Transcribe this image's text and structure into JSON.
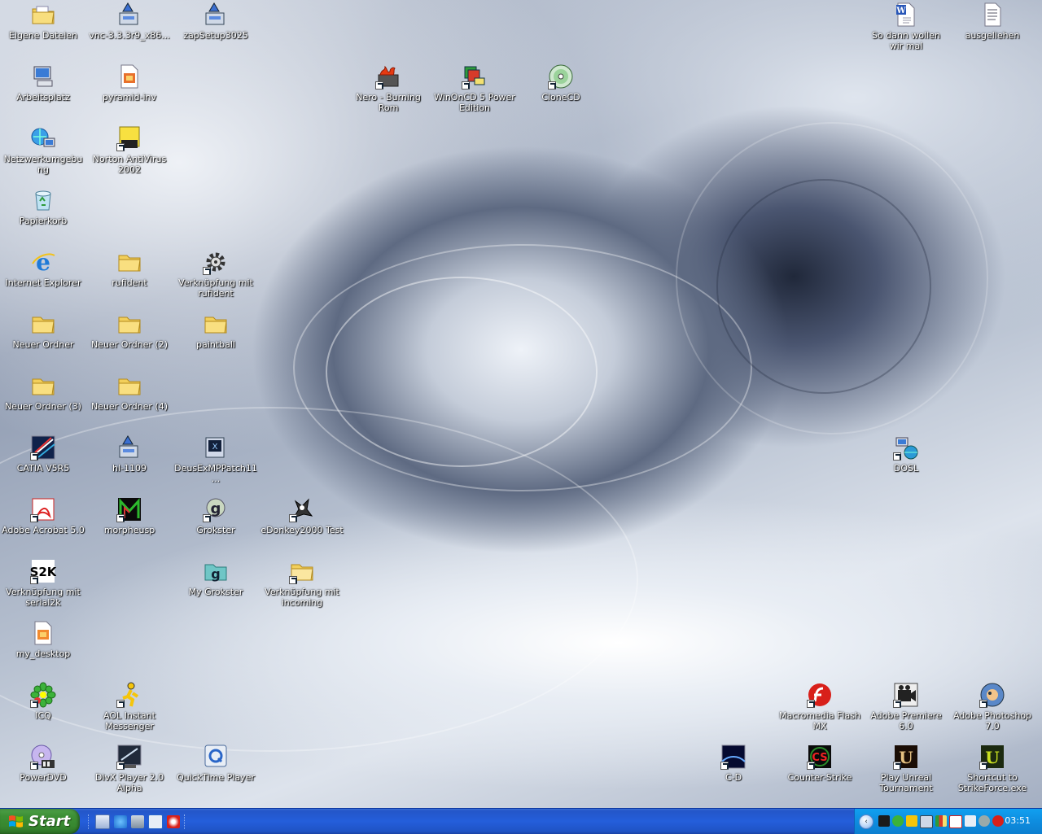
{
  "desktop": {
    "icons": [
      {
        "label": "Eigene Dateien",
        "icon": "folder-documents-icon"
      },
      {
        "label": "vnc-3.3.3r9_x86...",
        "icon": "installer-icon"
      },
      {
        "label": "zapSetup3025",
        "icon": "installer-icon"
      },
      {
        "label": "So dann wollen wir mal",
        "icon": "word-document-icon"
      },
      {
        "label": "ausgeliehen",
        "icon": "text-document-icon"
      },
      {
        "label": "Arbeitsplatz",
        "icon": "my-computer-icon"
      },
      {
        "label": "pyramid-inv",
        "icon": "image-file-icon"
      },
      {
        "label": "Nero - Burning Rom",
        "icon": "nero-icon"
      },
      {
        "label": "WinOnCD 5 Power Edition",
        "icon": "winoncd-icon"
      },
      {
        "label": "CloneCD",
        "icon": "cd-icon"
      },
      {
        "label": "Netzwerkumgebung",
        "icon": "network-icon"
      },
      {
        "label": "Norton AntiVirus 2002",
        "icon": "norton-icon"
      },
      {
        "label": "Papierkorb",
        "icon": "recycle-bin-icon"
      },
      {
        "label": "Internet Explorer",
        "icon": "internet-explorer-icon"
      },
      {
        "label": "rufident",
        "icon": "folder-icon"
      },
      {
        "label": "Verknüpfung mit rufident",
        "icon": "gear-icon"
      },
      {
        "label": "Neuer Ordner",
        "icon": "folder-icon"
      },
      {
        "label": "Neuer Ordner (2)",
        "icon": "folder-icon"
      },
      {
        "label": "paintball",
        "icon": "folder-icon"
      },
      {
        "label": "Neuer Ordner (3)",
        "icon": "folder-icon"
      },
      {
        "label": "Neuer Ordner (4)",
        "icon": "folder-icon"
      },
      {
        "label": "CATIA V5R5",
        "icon": "catia-icon"
      },
      {
        "label": "hl-1109",
        "icon": "installer-icon"
      },
      {
        "label": "DeusExMPPatch11...",
        "icon": "installer-icon"
      },
      {
        "label": "DOSL",
        "icon": "network-app-icon"
      },
      {
        "label": "Adobe Acrobat 5.0",
        "icon": "acrobat-icon"
      },
      {
        "label": "morpheusp",
        "icon": "morpheus-icon"
      },
      {
        "label": "Grokster",
        "icon": "grokster-icon"
      },
      {
        "label": "eDonkey2000 Test",
        "icon": "edonkey-icon"
      },
      {
        "label": "Verknüpfung mit serial2k",
        "icon": "serial2k-icon"
      },
      {
        "label": "My Grokster",
        "icon": "grokster-folder-icon"
      },
      {
        "label": "Verknüpfung mit incoming",
        "icon": "folder-icon"
      },
      {
        "label": "my_desktop",
        "icon": "image-file-icon"
      },
      {
        "label": "Macromedia Flash MX",
        "icon": "flash-icon"
      },
      {
        "label": "Adobe Premiere 6.0",
        "icon": "premiere-icon"
      },
      {
        "label": "Adobe Photoshop 7.0",
        "icon": "photoshop-icon"
      },
      {
        "label": "ICQ",
        "icon": "icq-icon"
      },
      {
        "label": "AOL Instant Messenger",
        "icon": "aim-icon"
      },
      {
        "label": "PowerDVD",
        "icon": "powerdvd-icon"
      },
      {
        "label": "DivX Player 2.0 Alpha",
        "icon": "divx-icon"
      },
      {
        "label": "QuickTime Player",
        "icon": "quicktime-icon"
      },
      {
        "label": "C-D",
        "icon": "game-icon"
      },
      {
        "label": "Counter-Strike",
        "icon": "counter-strike-icon"
      },
      {
        "label": "Play Unreal Tournament",
        "icon": "unreal-icon"
      },
      {
        "label": "Shortcut to StrikeForce.exe",
        "icon": "strikeforce-icon"
      }
    ]
  },
  "taskbar": {
    "start_label": "Start",
    "clock": "03:51"
  },
  "colors": {
    "taskbar_blue": "#245edb",
    "start_green": "#3c8f35",
    "tray_blue": "#0e8ddf"
  }
}
